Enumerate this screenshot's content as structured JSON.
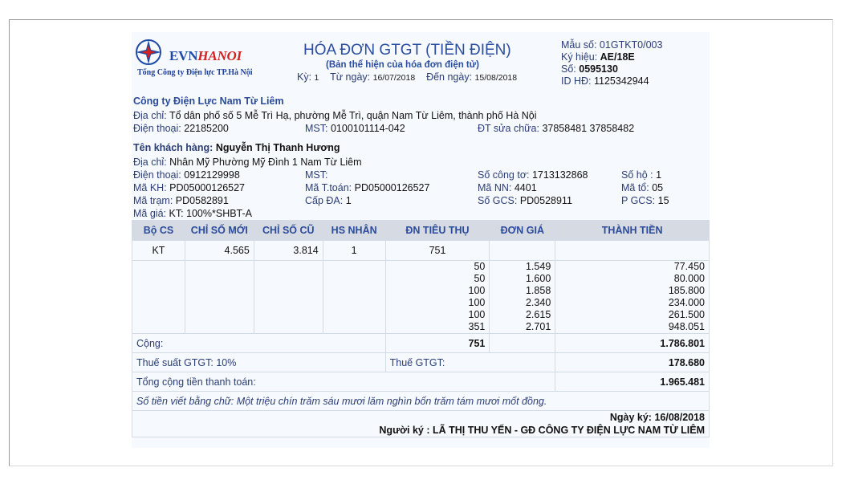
{
  "logo": {
    "brand_a": "EVN",
    "brand_b": "HANOI",
    "subtitle": "Tổng Công ty Điện lực TP.Hà Nội"
  },
  "header": {
    "title": "HÓA ĐƠN GTGT (TIỀN ĐIỆN)",
    "subtitle": "(Bản thể hiện của hóa đơn điện tử)",
    "ky_label": "Kỳ:",
    "ky_value": "1",
    "tu_ngay_label": "Từ ngày:",
    "tu_ngay_value": "16/07/2018",
    "den_ngay_label": "Đến ngày:",
    "den_ngay_value": "15/08/2018"
  },
  "meta": {
    "mau_so": "Mẫu số: 01GTKT0/003",
    "ky_hieu_label": "Ký hiệu:",
    "ky_hieu_value": "AE/18E",
    "so_label": "Số:",
    "so_value": "0595130",
    "id_hd_label": "ID HĐ:",
    "id_hd_value": "1125342944"
  },
  "seller": {
    "name": "Công ty Điện Lực Nam Từ Liêm",
    "address_label": "Địa chỉ:",
    "address_value": "Tổ dân phố số 5 Mễ Trì Hạ, phường Mễ Trì, quận Nam Từ Liêm, thành phố Hà Nội",
    "phone_label": "Điện thoại:",
    "phone_value": "22185200",
    "mst_label": "MST:",
    "mst_value": "0100101114-042",
    "repair_label": "ĐT sửa chữa:",
    "repair_value": "37858481 37858482"
  },
  "customer": {
    "name_label": "Tên khách hàng:",
    "name_value": "Nguyễn Thị Thanh Hương",
    "address_label": "Địa chỉ:",
    "address_value": "Nhân Mỹ Phường Mỹ Đình 1 Nam Từ Liêm",
    "phone_label": "Điện thoại:",
    "phone_value": "0912129998",
    "mst_label": "MST:",
    "mst_value": "",
    "meter_label": "Số công tơ:",
    "meter_value": "1713132868",
    "so_ho_label": "Số hộ :",
    "so_ho_value": "1",
    "ma_kh_label": "Mã KH:",
    "ma_kh_value": "PD05000126527",
    "ma_ttoan_label": "Mã T.toán:",
    "ma_ttoan_value": "PD05000126527",
    "ma_nn_label": "Mã NN:",
    "ma_nn_value": "4401",
    "ma_to_label": "Mã tổ:",
    "ma_to_value": "05",
    "ma_tram_label": "Mã trạm:",
    "ma_tram_value": "PD0582891",
    "cap_da_label": "Cấp ĐA:",
    "cap_da_value": "1",
    "so_gcs_label": "Số GCS:",
    "so_gcs_value": "PD0528911",
    "p_gcs_label": "P GCS:",
    "p_gcs_value": "15",
    "ma_gia_label": "Mã giá:",
    "ma_gia_value": "KT: 100%*SHBT-A"
  },
  "table": {
    "headers": [
      "Bộ CS",
      "CHỈ SỐ MỚI",
      "CHỈ SỐ CŨ",
      "HS NHÂN",
      "ĐN TIÊU THỤ",
      "ĐƠN GIÁ",
      "THÀNH TIỀN"
    ],
    "reading": {
      "bo_cs": "KT",
      "chi_so_moi": "4.565",
      "chi_so_cu": "3.814",
      "hs_nhan": "1",
      "dn_tieu_thu": "751"
    },
    "tiers": [
      {
        "kwh": "50",
        "price": "1.549",
        "amount": "77.450"
      },
      {
        "kwh": "50",
        "price": "1.600",
        "amount": "80.000"
      },
      {
        "kwh": "100",
        "price": "1.858",
        "amount": "185.800"
      },
      {
        "kwh": "100",
        "price": "2.340",
        "amount": "234.000"
      },
      {
        "kwh": "100",
        "price": "2.615",
        "amount": "261.500"
      },
      {
        "kwh": "351",
        "price": "2.701",
        "amount": "948.051"
      }
    ],
    "cong_label": "Cộng:",
    "cong_kwh": "751",
    "cong_amount": "1.786.801",
    "vat_rate_label": "Thuế suất GTGT: 10%",
    "vat_label": "Thuế GTGT:",
    "vat_amount": "178.680",
    "total_label": "Tổng cộng tiền thanh toán:",
    "total_amount": "1.965.481",
    "words_label": "Số tiền viết bằng chữ:",
    "words_value": "Một triệu chín trăm sáu mươi lăm nghìn bốn trăm tám mươi mốt đồng.",
    "sign_date": "Ngày ký: 16/08/2018",
    "signer": "Người ký : LÃ THỊ THU YẾN - GĐ CÔNG TY ĐIỆN LỰC NAM TỪ LIÊM"
  }
}
